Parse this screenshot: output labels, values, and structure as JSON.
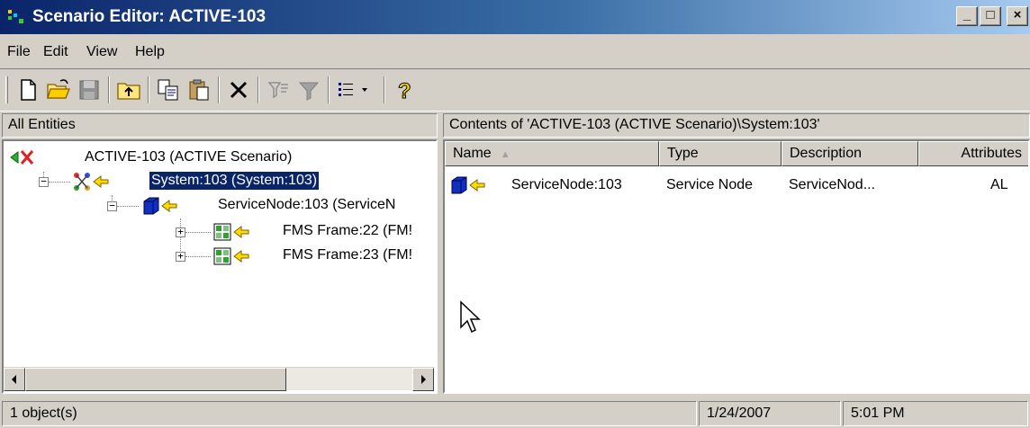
{
  "window": {
    "title": "Scenario Editor: ACTIVE-103"
  },
  "menu": [
    "File",
    "Edit",
    "View",
    "Help"
  ],
  "left_pane": {
    "header": "All Entities",
    "tree": [
      {
        "label": "ACTIVE-103 (ACTIVE Scenario)"
      },
      {
        "label": "System:103 (System:103)",
        "selected": true
      },
      {
        "label": "ServiceNode:103 (ServiceN"
      },
      {
        "label": "FMS Frame:22 (FM!"
      },
      {
        "label": "FMS Frame:23 (FM!"
      }
    ]
  },
  "right_pane": {
    "header": "Contents of 'ACTIVE-103 (ACTIVE Scenario)\\System:103'",
    "columns": [
      "Name",
      "Type",
      "Description",
      "Attributes"
    ],
    "rows": [
      {
        "name": "ServiceNode:103",
        "type": "Service Node",
        "description": "ServiceNod...",
        "attributes": "AL"
      }
    ]
  },
  "status": {
    "objects": "1 object(s)",
    "date": "1/24/2007",
    "time": "5:01 PM"
  },
  "colors": {
    "titlebar": "#0a246a",
    "selection": "#0a246a",
    "face": "#d4d0c8"
  }
}
